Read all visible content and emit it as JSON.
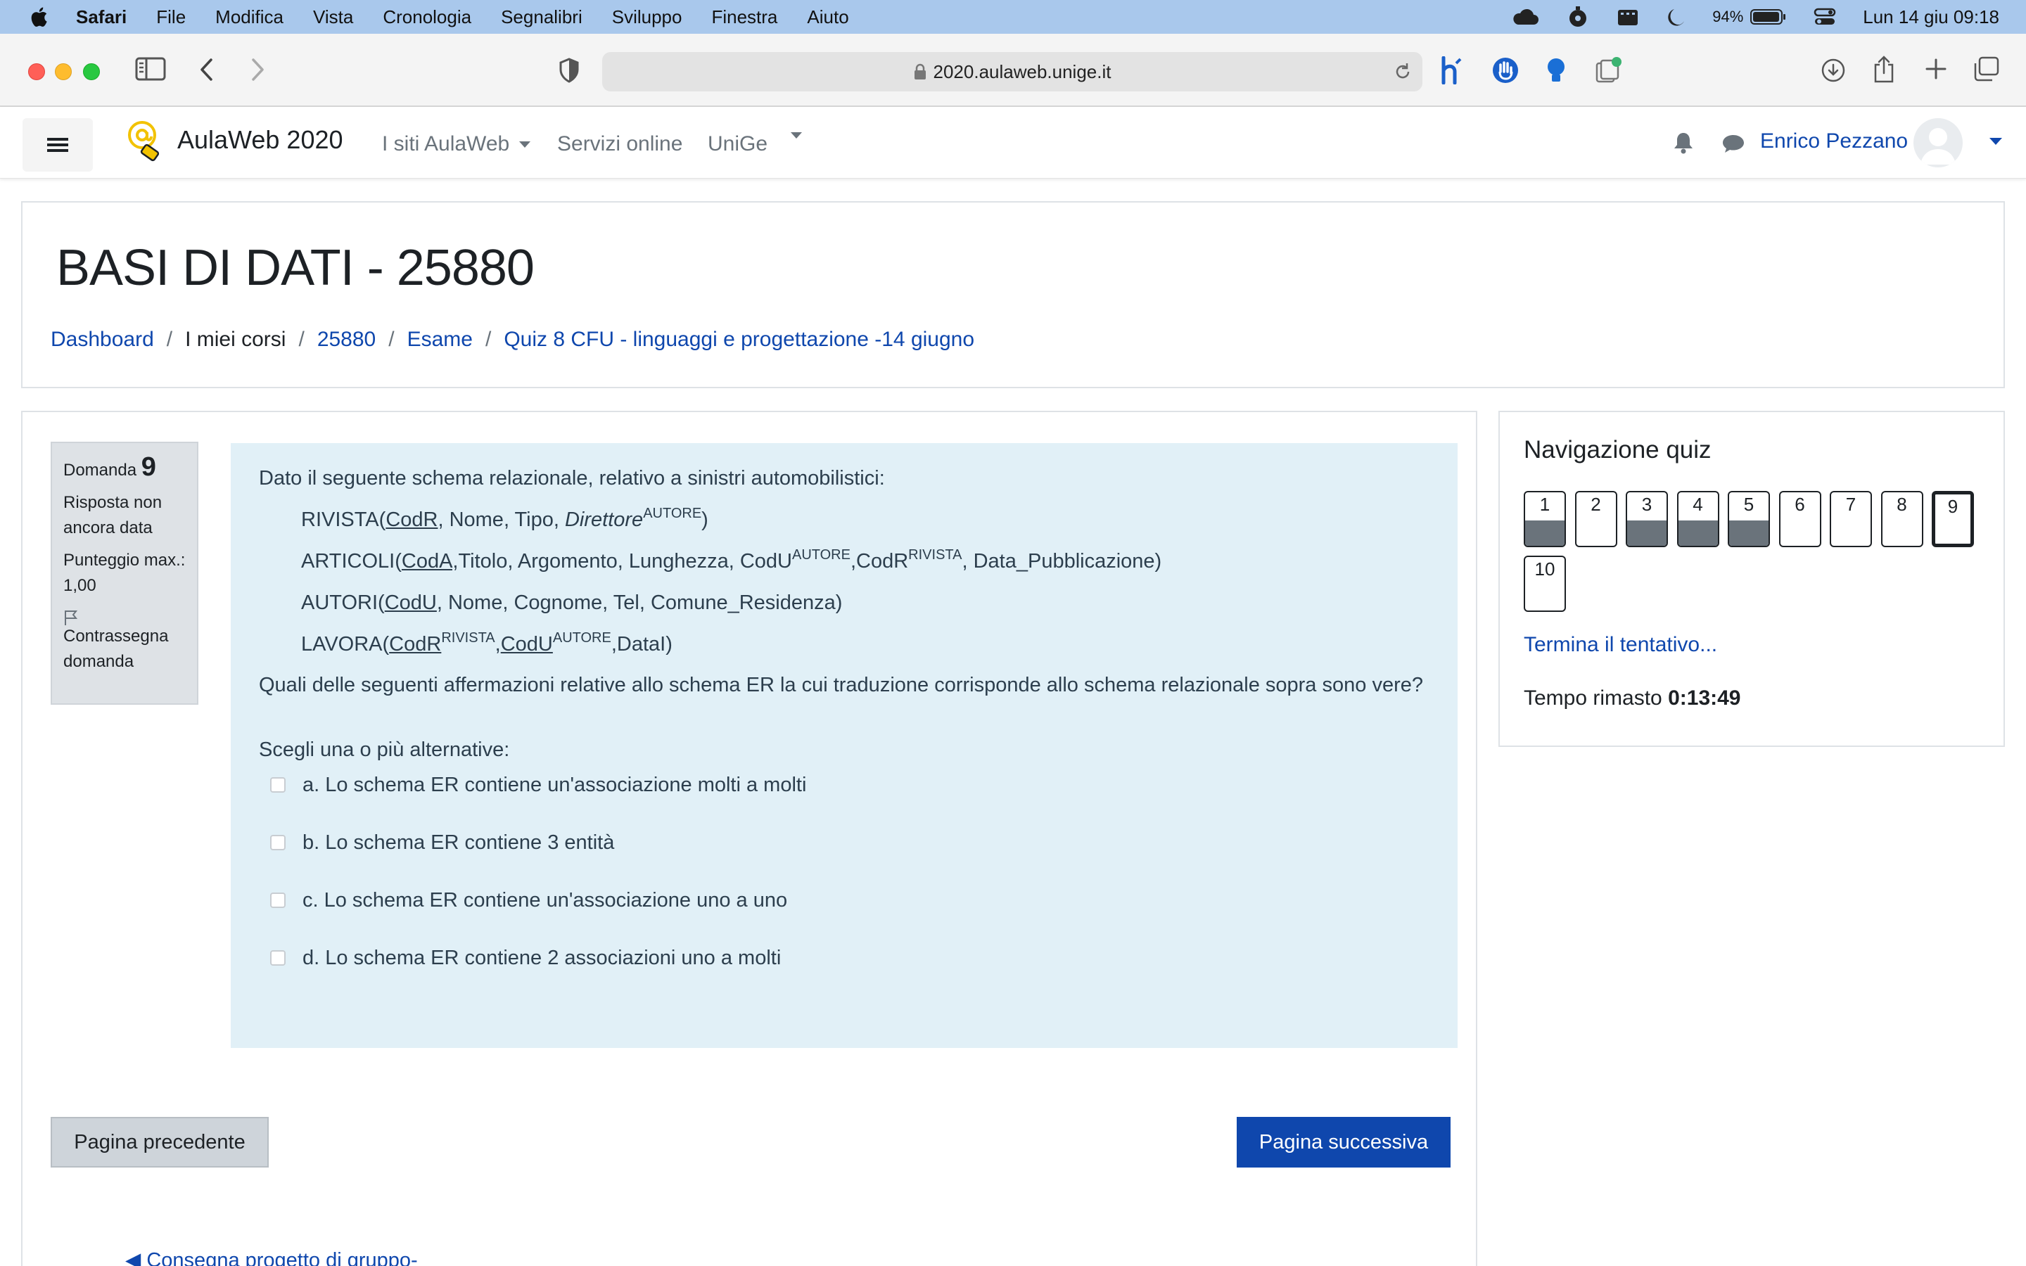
{
  "menubar": {
    "app": "Safari",
    "items": [
      "File",
      "Modifica",
      "Vista",
      "Cronologia",
      "Segnalibri",
      "Sviluppo",
      "Finestra",
      "Aiuto"
    ],
    "battery": "94%",
    "clock": "Lun 14 giu  09:18"
  },
  "browser": {
    "url": "2020.aulaweb.unige.it"
  },
  "navbar": {
    "brand": "AulaWeb 2020",
    "links": [
      "I siti AulaWeb",
      "Servizi online",
      "UniGe"
    ],
    "user": "Enrico Pezzano"
  },
  "header": {
    "course_title": "BASI DI DATI - 25880",
    "breadcrumb": [
      "Dashboard",
      "I miei corsi",
      "25880",
      "Esame",
      "Quiz 8 CFU - linguaggi e progettazione -14 giugno"
    ]
  },
  "question_info": {
    "label": "Domanda",
    "number": "9",
    "state": "Risposta non ancora data",
    "max_score": "Punteggio max.: 1,00",
    "flag": "Contrassegna domanda"
  },
  "question": {
    "intro": "Dato il seguente schema relazionale, relativo a sinistri automobilistici:",
    "schema": {
      "rivista": {
        "name": "RIVISTA(",
        "key": "CodR",
        "mid": ", Nome, Tipo, ",
        "fk": "Direttore",
        "sup": "AUTORE",
        "end": ")"
      },
      "articoli": {
        "name": "ARTICOLI(",
        "key": "CodA,",
        "mid": "Titolo, Argomento, Lunghezza, CodU",
        "sup1": "AUTORE",
        "mid2": ",CodR",
        "sup2": "RIVISTA",
        "end": ", Data_Pubblicazione)"
      },
      "autori": {
        "name": "AUTORI(",
        "key": "CodU",
        "end": ", Nome, Cognome, Tel, Comune_Residenza)"
      },
      "lavora": {
        "name": "LAVORA(",
        "key1": "CodR",
        "sup1": "RIVISTA",
        "comma": ",",
        "key2": "CodU",
        "sup2": "AUTORE",
        "end": ",DataI)"
      }
    },
    "text": "Quali delle seguenti affermazioni relative allo schema ER la cui traduzione corrisponde allo schema relazionale sopra sono vere?",
    "prompt": "Scegli una o più alternative:",
    "answers": [
      "a. Lo schema ER contiene un'associazione molti a molti",
      "b. Lo schema ER contiene 3 entità",
      "c. Lo schema ER contiene un'associazione uno a uno",
      "d. Lo schema ER contiene 2 associazioni uno a molti"
    ]
  },
  "buttons": {
    "previous": "Pagina precedente",
    "next": "Pagina successiva"
  },
  "activity_nav": {
    "previous": "◀ Consegna progetto di gruppo-"
  },
  "quiz_nav": {
    "title": "Navigazione quiz",
    "questions": [
      {
        "label": "1",
        "answered": true
      },
      {
        "label": "2",
        "answered": false
      },
      {
        "label": "3",
        "answered": true
      },
      {
        "label": "4",
        "answered": true
      },
      {
        "label": "5",
        "answered": true
      },
      {
        "label": "6",
        "answered": false
      },
      {
        "label": "7",
        "answered": false
      },
      {
        "label": "8",
        "answered": false
      },
      {
        "label": "9",
        "answered": false,
        "current": true
      },
      {
        "label": "10",
        "answered": false
      }
    ],
    "finish": "Termina il tentativo...",
    "time_label": "Tempo rimasto",
    "time_value": "0:13:49"
  },
  "colors": {
    "link": "#0f47ad",
    "question_bg": "#e1f0f7",
    "answered_fill": "#6a737b",
    "menubar_bg": "#a9c8ec"
  }
}
